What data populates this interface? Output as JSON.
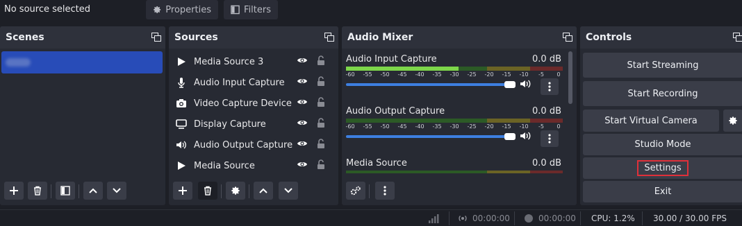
{
  "topbar": {
    "source_status": "No source selected",
    "properties_label": "Properties",
    "filters_label": "Filters"
  },
  "scenes": {
    "title": "Scenes"
  },
  "sources": {
    "title": "Sources",
    "items": [
      {
        "label": "Media Source 3",
        "icon": "play-icon"
      },
      {
        "label": "Audio Input Capture",
        "icon": "microphone-icon"
      },
      {
        "label": "Video Capture Device",
        "icon": "camera-icon"
      },
      {
        "label": "Display Capture",
        "icon": "monitor-icon"
      },
      {
        "label": "Audio Output Capture",
        "icon": "speaker-icon"
      },
      {
        "label": "Media Source",
        "icon": "play-icon"
      }
    ]
  },
  "audio_mixer": {
    "title": "Audio Mixer",
    "ticks": [
      "-60",
      "-55",
      "-50",
      "-45",
      "-40",
      "-35",
      "-30",
      "-25",
      "-20",
      "-15",
      "-10",
      "-5",
      "0"
    ],
    "channels": [
      {
        "name": "Audio Input Capture",
        "db": "0.0 dB",
        "level": 0.52,
        "volume": 1.0
      },
      {
        "name": "Audio Output Capture",
        "db": "0.0 dB",
        "level": 0.0,
        "volume": 1.0
      },
      {
        "name": "Media Source",
        "db": "0.0 dB",
        "level": 0.0
      }
    ]
  },
  "controls": {
    "title": "Controls",
    "start_streaming": "Start Streaming",
    "start_recording": "Start Recording",
    "start_virtual_camera": "Start Virtual Camera",
    "studio_mode": "Studio Mode",
    "settings": "Settings",
    "exit": "Exit"
  },
  "status": {
    "stream_time": "00:00:00",
    "record_time": "00:00:00",
    "cpu": "CPU: 1.2%",
    "fps": "30.00 / 30.00 FPS"
  },
  "colors": {
    "accent": "#284cb8",
    "slider": "#3d7fe0",
    "highlight_box": "#e0303a"
  }
}
